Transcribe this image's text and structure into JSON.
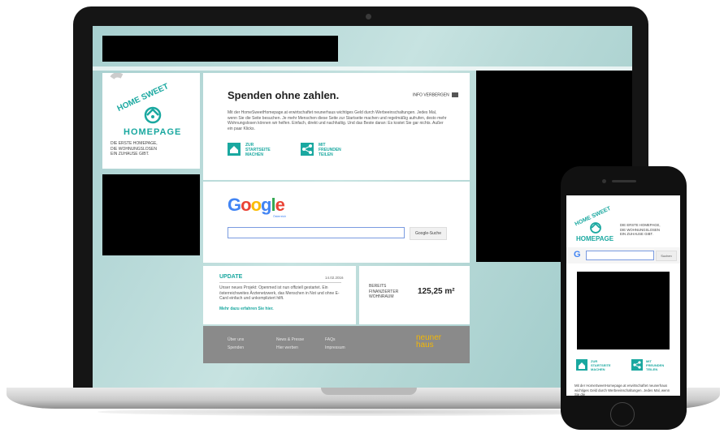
{
  "brand": {
    "logo_top": "HOME SWEET",
    "logo_bottom": "HOMEPAGE",
    "tagline": "DIE ERSTE HOMEPAGE,\nDIE WOHNUNGSLOSEN\nEIN ZUHAUSE GIBT.",
    "teal": "#1aa8a0"
  },
  "intro": {
    "title": "Spenden ohne zahlen.",
    "hide_info": "INFO VERBERGEN",
    "text": "Mit der HomeSweetHomepage.at erwirtschaftet neunerhaus wichtiges Geld durch Werbeeinschaltungen. Jedes Mal, wenn Sie die Seite besuchen. Je mehr Menschen diese Seite zur Startseite machen und regelmäßig aufrufen, desto mehr Wohnungslosen können wir helfen. Einfach, direkt und nachhaltig. Und das Beste daran: Es kostet Sie gar nichts. Außer ein paar Klicks.",
    "action_home": "ZUR\nSTARTSEITE\nMACHEN",
    "action_share": "MIT\nFREUNDEN\nTEILEN"
  },
  "search": {
    "google_sub": "Österreich",
    "button": "Google-Suche",
    "mobile_button": "Suchen"
  },
  "update": {
    "label": "UPDATE",
    "date": "14.02.2016",
    "text": "Unser neues Projekt: Openmed ist nun offiziell gestartet. Ein österreichweites Ärztenetzwerk, das Menschen in Not und ohne E-Card einfach und unkompliziert hilft.",
    "link": "Mehr dazu erfahren Sie hier."
  },
  "stats": {
    "label": "BEREITS\nFINANZIERTER\nWOHNRAUM",
    "value": "125,25 m²"
  },
  "footer": {
    "links": [
      "Über uns",
      "Spenden",
      "News & Presse",
      "Hier werben",
      "FAQs",
      "Impressum"
    ],
    "logo_line1": "neuner",
    "logo_line2": "haus"
  },
  "mobile": {
    "text": "Mit der HomeSweetHomepage.at erwirtschaftet neunerhaus wichtiges Geld durch Werbeeinschaltungen. Jedes Mal, wenn Sie die"
  }
}
